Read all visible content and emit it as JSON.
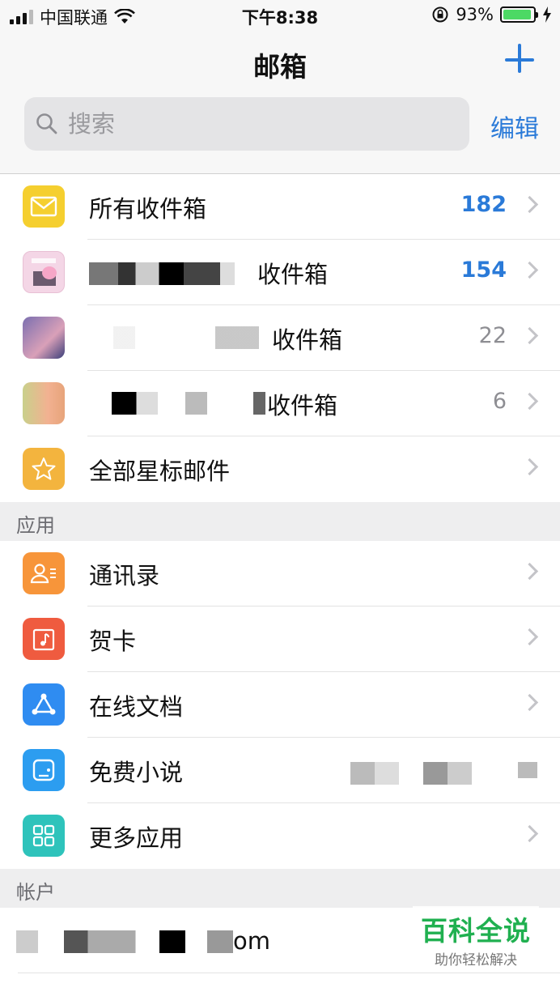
{
  "status_bar": {
    "carrier": "中国联通",
    "time": "下午8:38",
    "battery": "93%"
  },
  "nav": {
    "title": "邮箱",
    "add_icon": "plus-icon"
  },
  "search": {
    "placeholder": "搜索",
    "edit_label": "编辑"
  },
  "mailboxes": [
    {
      "label": "所有收件箱",
      "count": "182",
      "icon": "envelope-icon",
      "color": "#f5cf2f"
    },
    {
      "label": "收件箱",
      "count": "154"
    },
    {
      "label": "收件箱",
      "count": "22"
    },
    {
      "label": "收件箱",
      "count": "6"
    },
    {
      "label": "全部星标邮件",
      "count": "",
      "icon": "star-icon",
      "color": "#f3b43e"
    }
  ],
  "apps_section": "应用",
  "apps": [
    {
      "label": "通讯录",
      "icon": "contacts-icon",
      "color": "#f7953a"
    },
    {
      "label": "贺卡",
      "icon": "card-icon",
      "color": "#ef5b3f"
    },
    {
      "label": "在线文档",
      "icon": "document-share-icon",
      "color": "#2f8cf1"
    },
    {
      "label": "免费小说",
      "icon": "novel-icon",
      "color": "#2c9df0"
    },
    {
      "label": "更多应用",
      "icon": "grid-icon",
      "color": "#2ec3bb"
    }
  ],
  "accounts_section": "帐户",
  "account": {
    "partial_text": "om"
  },
  "watermark": {
    "title": "百科全说",
    "subtitle": "助你轻松解决"
  }
}
